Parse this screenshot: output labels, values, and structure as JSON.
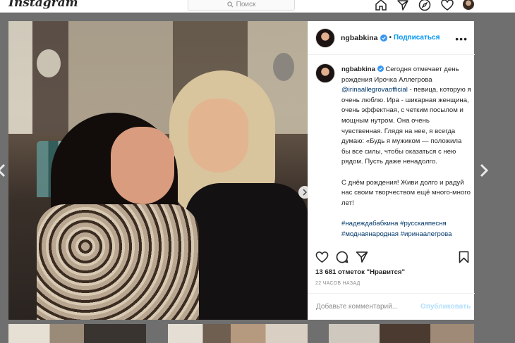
{
  "topbar": {
    "logo": "Instagram",
    "search_placeholder": "Поиск"
  },
  "post": {
    "username": "ngbabkina",
    "follow_label": "Подписаться",
    "separator": "•",
    "caption": {
      "username": "ngbabkina",
      "part1": "Сегодня отмечает день рождения Ирочка Аллегрова",
      "mention": "@irinaallegrovaofficial",
      "part2": "- певица, которую я очень люблю. Ира - шикарная женщина, очень эффектная, с четким посылом и мощным нутром. Она очень чувственная. Глядя на нее, я всегда думаю: «Будь я мужиком — положила бы все силы, чтобы оказаться с нею рядом. Пусть даже ненадолго.",
      "paragraph2": "С днём рождения! Живи долго и радуй нас своим творчеством ещё много-много лет!",
      "hashtags": "#надеждабабкина #русскаяпесня #моднаянародная #иринаалегрова"
    },
    "likes": "13 681 отметок \"Нравится\"",
    "time": "22 ЧАСОВ НАЗАД",
    "comment_placeholder": "Добавьте комментарий...",
    "publish_label": "Опубликовать"
  },
  "colors": {
    "accent": "#0095f6",
    "link": "#00376b",
    "publish_disabled": "#b2dffc"
  },
  "icons": [
    "home-icon",
    "direct-icon",
    "explore-icon",
    "heart-icon",
    "like-icon",
    "comment-icon",
    "share-icon",
    "bookmark-icon",
    "verified-icon",
    "search-icon",
    "more-icon"
  ]
}
